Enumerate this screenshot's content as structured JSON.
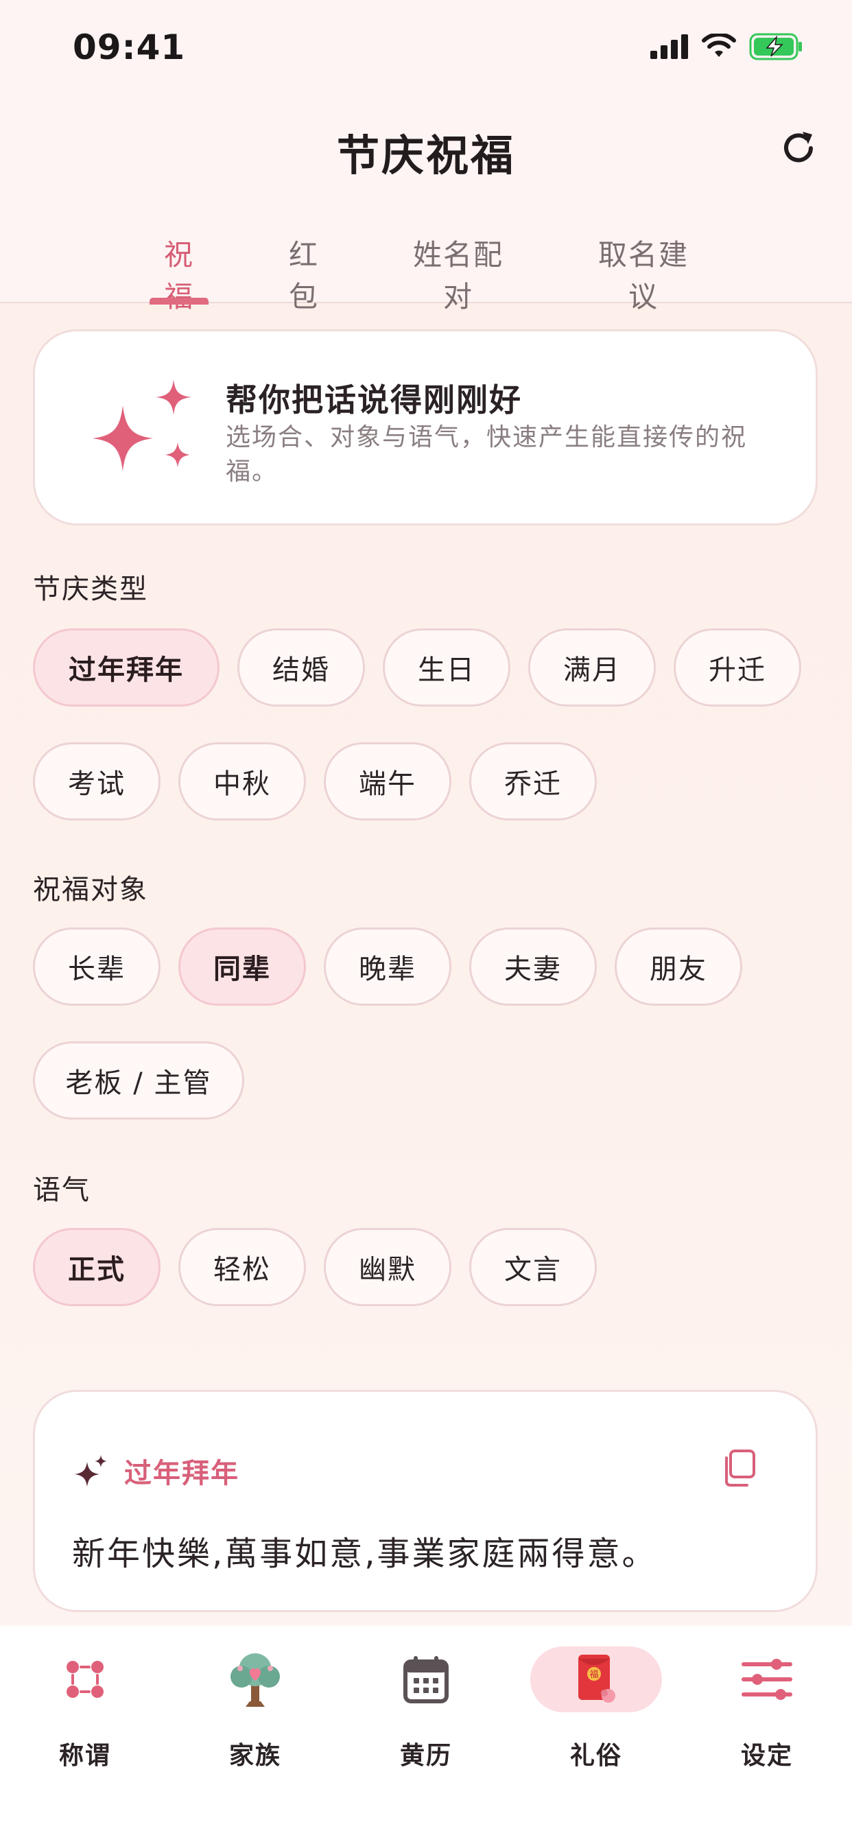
{
  "status_bar": {
    "time": "09:41"
  },
  "header": {
    "title": "节庆祝福"
  },
  "tabs": [
    {
      "label": "祝福",
      "active": true
    },
    {
      "label": "红包",
      "active": false
    },
    {
      "label": "姓名配对",
      "active": false
    },
    {
      "label": "取名建议",
      "active": false
    }
  ],
  "hero": {
    "title": "帮你把话说得刚刚好",
    "description": "选场合、对象与语气，快速产生能直接传的祝福。"
  },
  "sections": {
    "festival": {
      "label": "节庆类型",
      "options": [
        "过年拜年",
        "结婚",
        "生日",
        "满月",
        "升迁",
        "考试",
        "中秋",
        "端午",
        "乔迁"
      ],
      "selected": "过年拜年"
    },
    "target": {
      "label": "祝福对象",
      "options": [
        "长辈",
        "同辈",
        "晚辈",
        "夫妻",
        "朋友",
        "老板 / 主管"
      ],
      "selected": "同辈"
    },
    "tone": {
      "label": "语气",
      "options": [
        "正式",
        "轻松",
        "幽默",
        "文言"
      ],
      "selected": "正式"
    }
  },
  "result": {
    "tag": "过年拜年",
    "text": "新年快樂,萬事如意,事業家庭兩得意。"
  },
  "bottom_nav": [
    {
      "label": "称谓",
      "icon": "kinship-dots-icon",
      "active": false
    },
    {
      "label": "家族",
      "icon": "family-tree-icon",
      "active": false
    },
    {
      "label": "黄历",
      "icon": "calendar-icon",
      "active": false
    },
    {
      "label": "礼俗",
      "icon": "red-envelope-icon",
      "active": true
    },
    {
      "label": "设定",
      "icon": "sliders-icon",
      "active": false
    }
  ],
  "colors": {
    "accent": "#d65d75",
    "chip_selected": "#fce3e6",
    "background": "#fdf0ea"
  }
}
